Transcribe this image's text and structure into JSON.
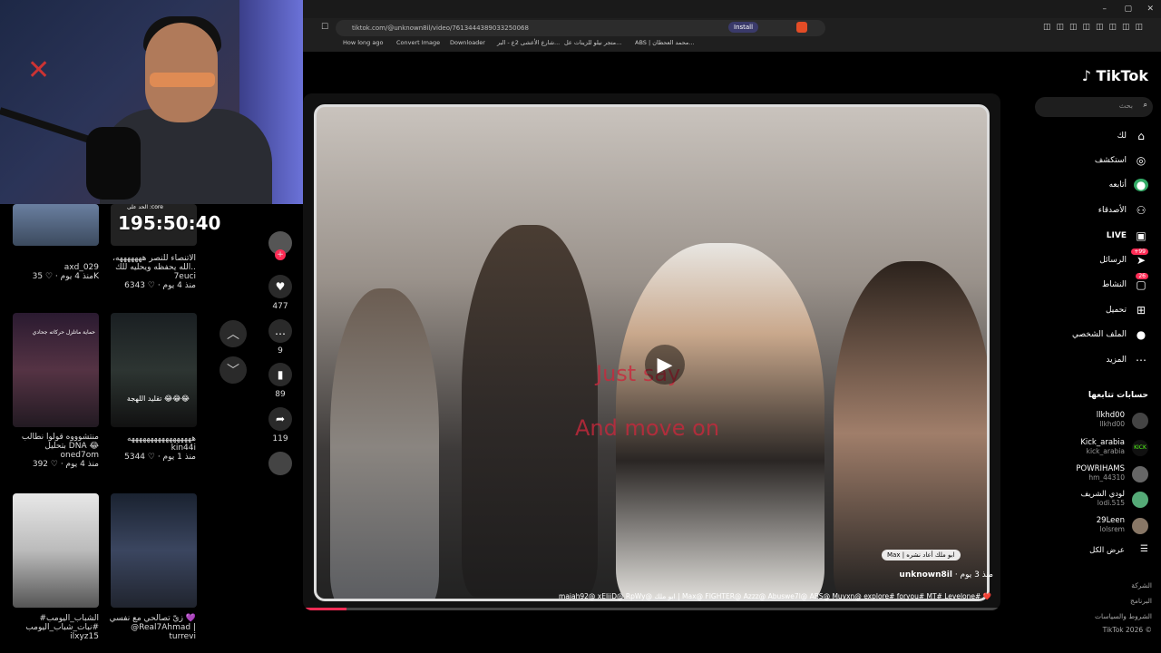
{
  "browser": {
    "url": "tiktok.com/@unknown8il/video/7613444389033250068",
    "install_label": "Install",
    "bookmarks": [
      "How long ago",
      "Convert Image",
      "Downloader",
      "شارع الأعشى 2ع - البر...",
      "متجر نيلو للزينات عل...",
      "ABS | محمد العحطان..."
    ]
  },
  "overlay": {
    "timer": "195:50:40",
    "timer_label": "الحد على :core"
  },
  "left_feed": {
    "items": [
      {
        "caption": "",
        "user": "axd_029",
        "likes": "35K",
        "age": "منذ 4 يوم"
      },
      {
        "caption": "الاتنصاء للنصر هههههههه، الله يحفظه ويحليه للك..",
        "user": "7euci",
        "likes": "6343",
        "age": "منذ 4 يوم"
      },
      {
        "caption": "منتشوووه قولوا نطالب بتحليل DNA 😂",
        "user": "oned7om",
        "likes": "392",
        "age": "منذ 4 يوم"
      },
      {
        "caption": "هههههههههههههههههه",
        "user": "kin44i",
        "likes": "5344",
        "age": "منذ 1 يوم"
      },
      {
        "caption": "#الشباب_اليومب #نبات_شباب_اليومب",
        "user": "ilxyz15",
        "likes": "",
        "age": ""
      },
      {
        "caption": "زيّ تصالحي مع نفسي 💜 @Real7Ahmad |",
        "user": "turrevi",
        "likes": "",
        "age": ""
      }
    ],
    "thumb_texts": [
      "حماية ماتلزل حركاته جحادي",
      "تقليد اللهجة 😂😂😂"
    ]
  },
  "actions": {
    "likes": "477",
    "comments": "9",
    "saves": "89",
    "shares": "119"
  },
  "video": {
    "author": "unknown8il",
    "age": "منذ 3 يوم",
    "repost": "Max | ابو ملك أعاد نشره",
    "caption": "majah92@ xEliiD@ RpWy@ ابو ملك | Max@ FIGHTER@ Azzz@ Abuswe7l@ ABS@ Muvxn@ explore# foryou# MT# Levelone# ❤️",
    "overlay_lines": [
      "Just say",
      "And move on"
    ]
  },
  "sidebar": {
    "logo": "TikTok",
    "search_placeholder": "بحث",
    "nav": [
      {
        "label": "لك",
        "icon": "home-icon"
      },
      {
        "label": "استكشف",
        "icon": "compass-icon"
      },
      {
        "label": "أتابعه",
        "icon": "following-icon"
      },
      {
        "label": "الأصدقاء",
        "icon": "friends-icon"
      },
      {
        "label": "LIVE",
        "icon": "live-icon"
      },
      {
        "label": "الرسائل",
        "icon": "messages-icon",
        "badge": "+99"
      },
      {
        "label": "النشاط",
        "icon": "activity-icon",
        "badge": "26"
      },
      {
        "label": "تحميل",
        "icon": "upload-icon"
      },
      {
        "label": "الملف الشخصي",
        "icon": "profile-icon"
      },
      {
        "label": "المزيد",
        "icon": "more-icon"
      }
    ],
    "following_title": "حسابات تتابعها",
    "following": [
      {
        "name": "llkhd00",
        "handle": "llkhd00"
      },
      {
        "name": "Kick_arabia",
        "handle": "kick_arabia"
      },
      {
        "name": "POWRIHAMS",
        "handle": "hm_44310"
      },
      {
        "name": "لودي الشريف",
        "handle": "lodi.515"
      },
      {
        "name": "29Leen",
        "handle": "lolsrem"
      }
    ],
    "show_all": "عرض الكل",
    "footer": [
      "الشركة",
      "البرنامج",
      "الشروط والسياسات",
      "TikTok 2026 ©"
    ]
  }
}
